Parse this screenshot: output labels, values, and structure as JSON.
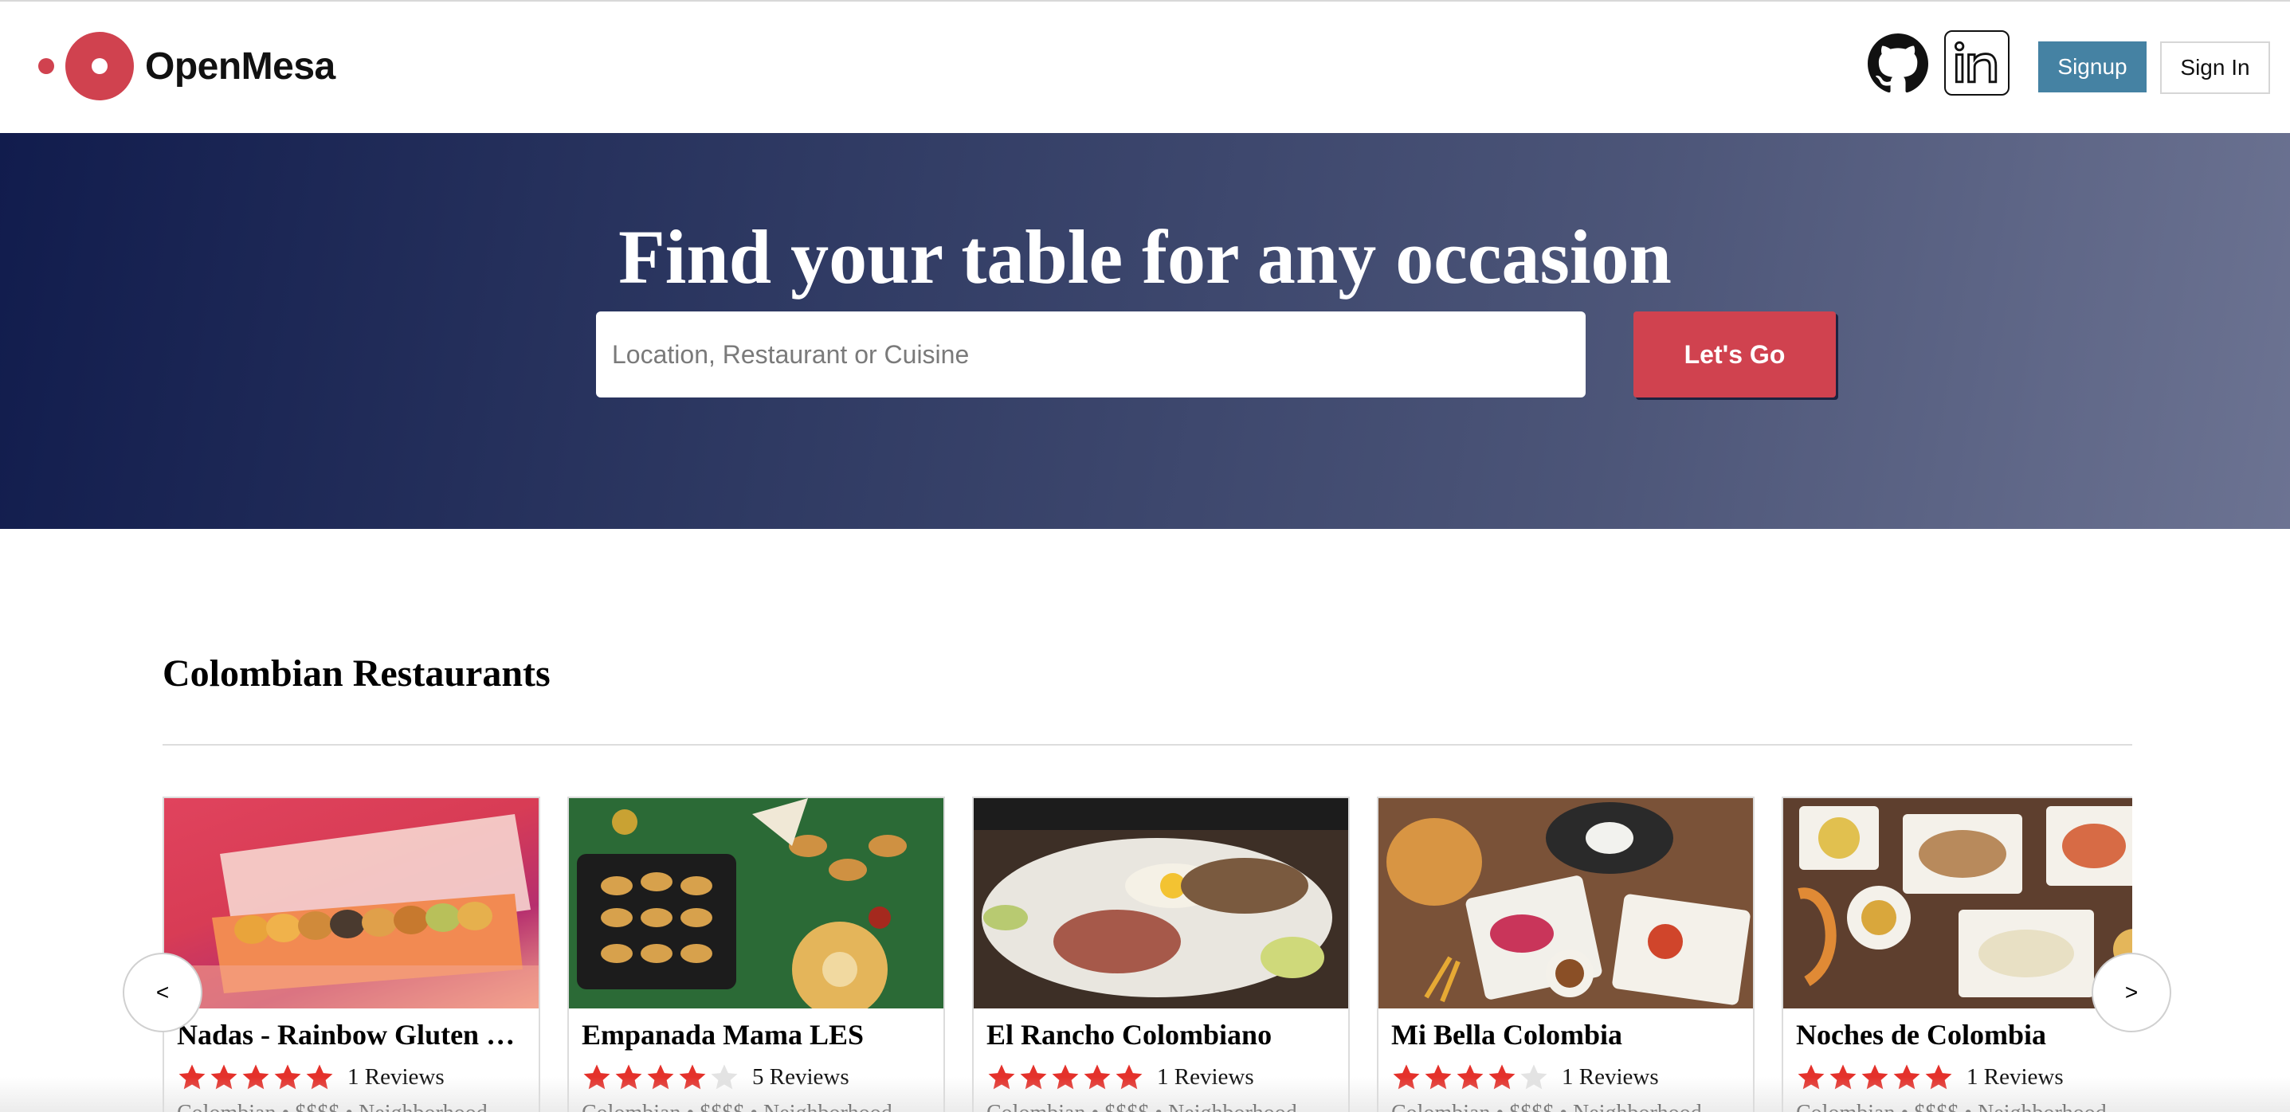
{
  "brand": {
    "name": "OpenMesa",
    "accent": "#d0424f"
  },
  "header": {
    "signup_label": "Signup",
    "signin_label": "Sign In",
    "icons": [
      "github-icon",
      "linkedin-icon"
    ]
  },
  "hero": {
    "title": "Find your table for any occasion",
    "search_placeholder": "Location, Restaurant or Cuisine",
    "search_value": "",
    "button_label": "Let's Go"
  },
  "section": {
    "title": "Colombian Restaurants",
    "prev_label": "<",
    "next_label": ">",
    "restaurants": [
      {
        "name": "Nadas - Rainbow Gluten Free Empanadas",
        "stars": 5,
        "reviews": "1 Reviews",
        "meta": "Colombian • $$$$ • Neighborhood"
      },
      {
        "name": "Empanada Mama LES",
        "stars": 4,
        "reviews": "5 Reviews",
        "meta": "Colombian • $$$$ • Neighborhood"
      },
      {
        "name": "El Rancho Colombiano",
        "stars": 5,
        "reviews": "1 Reviews",
        "meta": "Colombian • $$$$ • Neighborhood"
      },
      {
        "name": "Mi Bella Colombia",
        "stars": 4,
        "reviews": "1 Reviews",
        "meta": "Colombian • $$$$ • Neighborhood"
      },
      {
        "name": "Noches de Colombia",
        "stars": 5,
        "reviews": "1 Reviews",
        "meta": "Colombian • $$$$ • Neighborhood"
      }
    ]
  },
  "colors": {
    "star_filled": "#e4312b",
    "star_empty": "#e3e3e3",
    "signup": "#4582a3"
  }
}
